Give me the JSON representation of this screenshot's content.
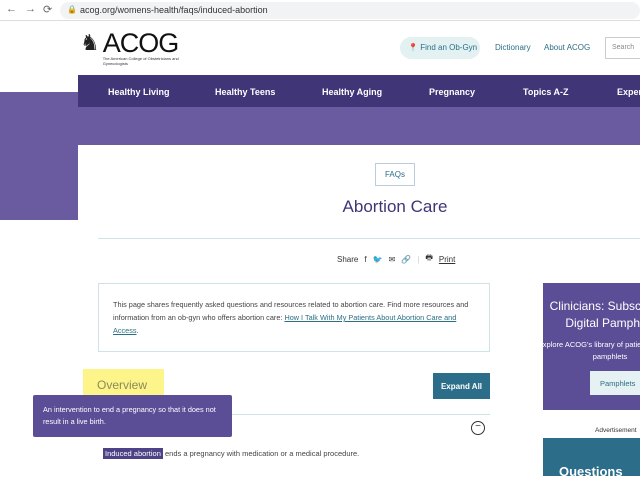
{
  "browser": {
    "url": "acog.org/womens-health/faqs/induced-abortion"
  },
  "header": {
    "logo_name": "ACOG",
    "logo_sub": "The American College of Obstetricians and Gynecologists",
    "find_ob": "Find an Ob-Gyn",
    "dictionary": "Dictionary",
    "about": "About ACOG",
    "search_placeholder": "Search"
  },
  "nav": [
    "Healthy Living",
    "Healthy Teens",
    "Healthy Aging",
    "Pregnancy",
    "Topics A-Z",
    "Experts"
  ],
  "page": {
    "badge": "FAQs",
    "title": "Abortion Care",
    "share_label": "Share",
    "print_label": "Print",
    "intro": "This page shares frequently asked questions and resources related to abortion care. Find more resources and information from an ob-gyn who offers abortion care: ",
    "intro_link": "How I Talk With My Patients About Abortion Care and Access",
    "intro_end": ".",
    "section": "Overview",
    "expand_all": "Expand All",
    "tooltip": "An intervention to end a pregnancy so that it does not result in a live birth.",
    "term": "Induced abortion",
    "body": " ends a pregnancy with medication or a medical procedure."
  },
  "sidebar": {
    "heading": "Clinicians: Subscribe to Digital Pamphlets",
    "text": "Explore ACOG's library of patient education pamphlets",
    "button": "Pamphlets",
    "ad_label": "Advertisement",
    "ad_title": "Questions"
  }
}
